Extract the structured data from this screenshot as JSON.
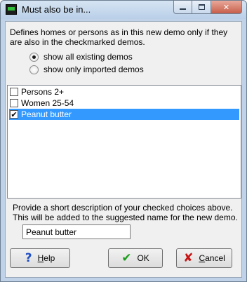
{
  "window": {
    "title": "Must also be in..."
  },
  "description": "Defines homes or persons as in this new demo only if they are also in the checkmarked demos.",
  "radio_options": [
    {
      "label": "show all existing demos",
      "checked": true
    },
    {
      "label": "show only imported demos",
      "checked": false
    }
  ],
  "list_items": [
    {
      "label": "Persons 2+",
      "checked": false,
      "selected": false
    },
    {
      "label": "Women 25-54",
      "checked": false,
      "selected": false
    },
    {
      "label": "Peanut butter",
      "checked": true,
      "selected": true
    }
  ],
  "note": "Provide a short description of your checked choices above.  This will be added to the suggested name for the new demo.",
  "short_description": {
    "value": "Peanut butter"
  },
  "buttons": {
    "help": {
      "mnemonic": "H",
      "rest": "elp",
      "icon": "question-icon",
      "color": "#1f4fc4"
    },
    "ok": {
      "label": "OK",
      "icon": "checkmark-icon",
      "color": "#1e9e1e"
    },
    "cancel": {
      "mnemonic": "C",
      "rest": "ancel",
      "icon": "x-icon",
      "color": "#c81414"
    }
  }
}
